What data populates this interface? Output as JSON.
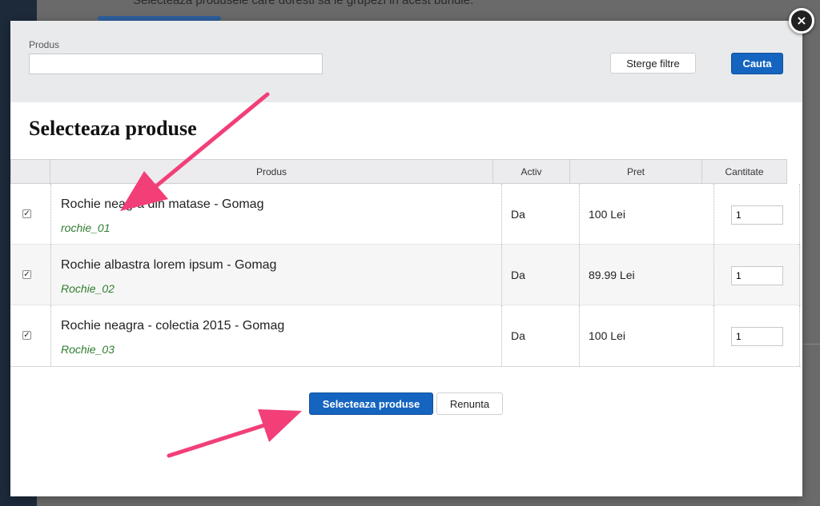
{
  "background": {
    "text": "Selecteaza produsele care doresti sa le grupezi in acest bundle."
  },
  "modal": {
    "close_glyph": "×",
    "filter": {
      "label": "Produs",
      "value": "",
      "placeholder": "",
      "clear_label": "Sterge filtre",
      "search_label": "Cauta"
    },
    "title": "Selecteaza produse",
    "columns": [
      "Produs",
      "Activ",
      "Pret",
      "Cantitate"
    ],
    "rows": [
      {
        "checked": true,
        "name": "Rochie neagra din matase - Gomag",
        "code": "rochie_01",
        "activ": "Da",
        "pret": "100 Lei",
        "qty": "1"
      },
      {
        "checked": true,
        "name": "Rochie albastra lorem ipsum - Gomag",
        "code": "Rochie_02",
        "activ": "Da",
        "pret": "89.99 Lei",
        "qty": "1"
      },
      {
        "checked": true,
        "name": "Rochie neagra - colectia 2015 - Gomag",
        "code": "Rochie_03",
        "activ": "Da",
        "pret": "100 Lei",
        "qty": "1"
      }
    ],
    "submit_label": "Selecteaza produse",
    "cancel_label": "Renunta"
  },
  "colors": {
    "primary": "#1565c0",
    "code_green": "#2f7d2f",
    "annotation_arrow": "#f23f78"
  },
  "icons": {
    "close": "close-icon",
    "checkbox": "check-icon",
    "annotation": "arrow-icon"
  }
}
